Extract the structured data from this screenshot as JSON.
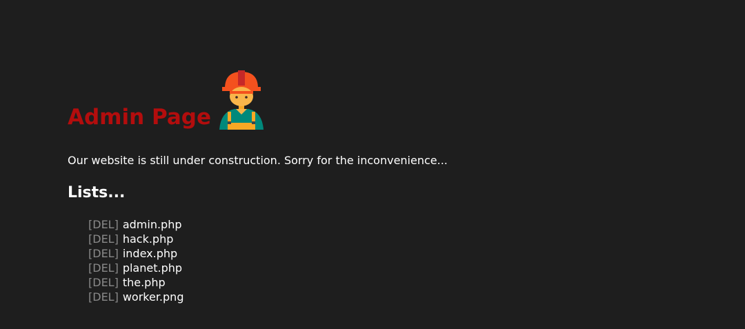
{
  "header": {
    "title": "Admin Page",
    "worker_icon": "construction-worker-icon"
  },
  "main": {
    "notice": "Our website is still under construction. Sorry for the inconvenience...",
    "lists_heading": "Lists...",
    "delete_label": "[DEL]",
    "files": [
      {
        "name": "admin.php"
      },
      {
        "name": "hack.php"
      },
      {
        "name": "index.php"
      },
      {
        "name": "planet.php"
      },
      {
        "name": "the.php"
      },
      {
        "name": "worker.png"
      }
    ]
  },
  "colors": {
    "background": "#1e1e1e",
    "title": "#b30d0d",
    "delete": "#8a8a8a",
    "text": "#ffffff"
  }
}
